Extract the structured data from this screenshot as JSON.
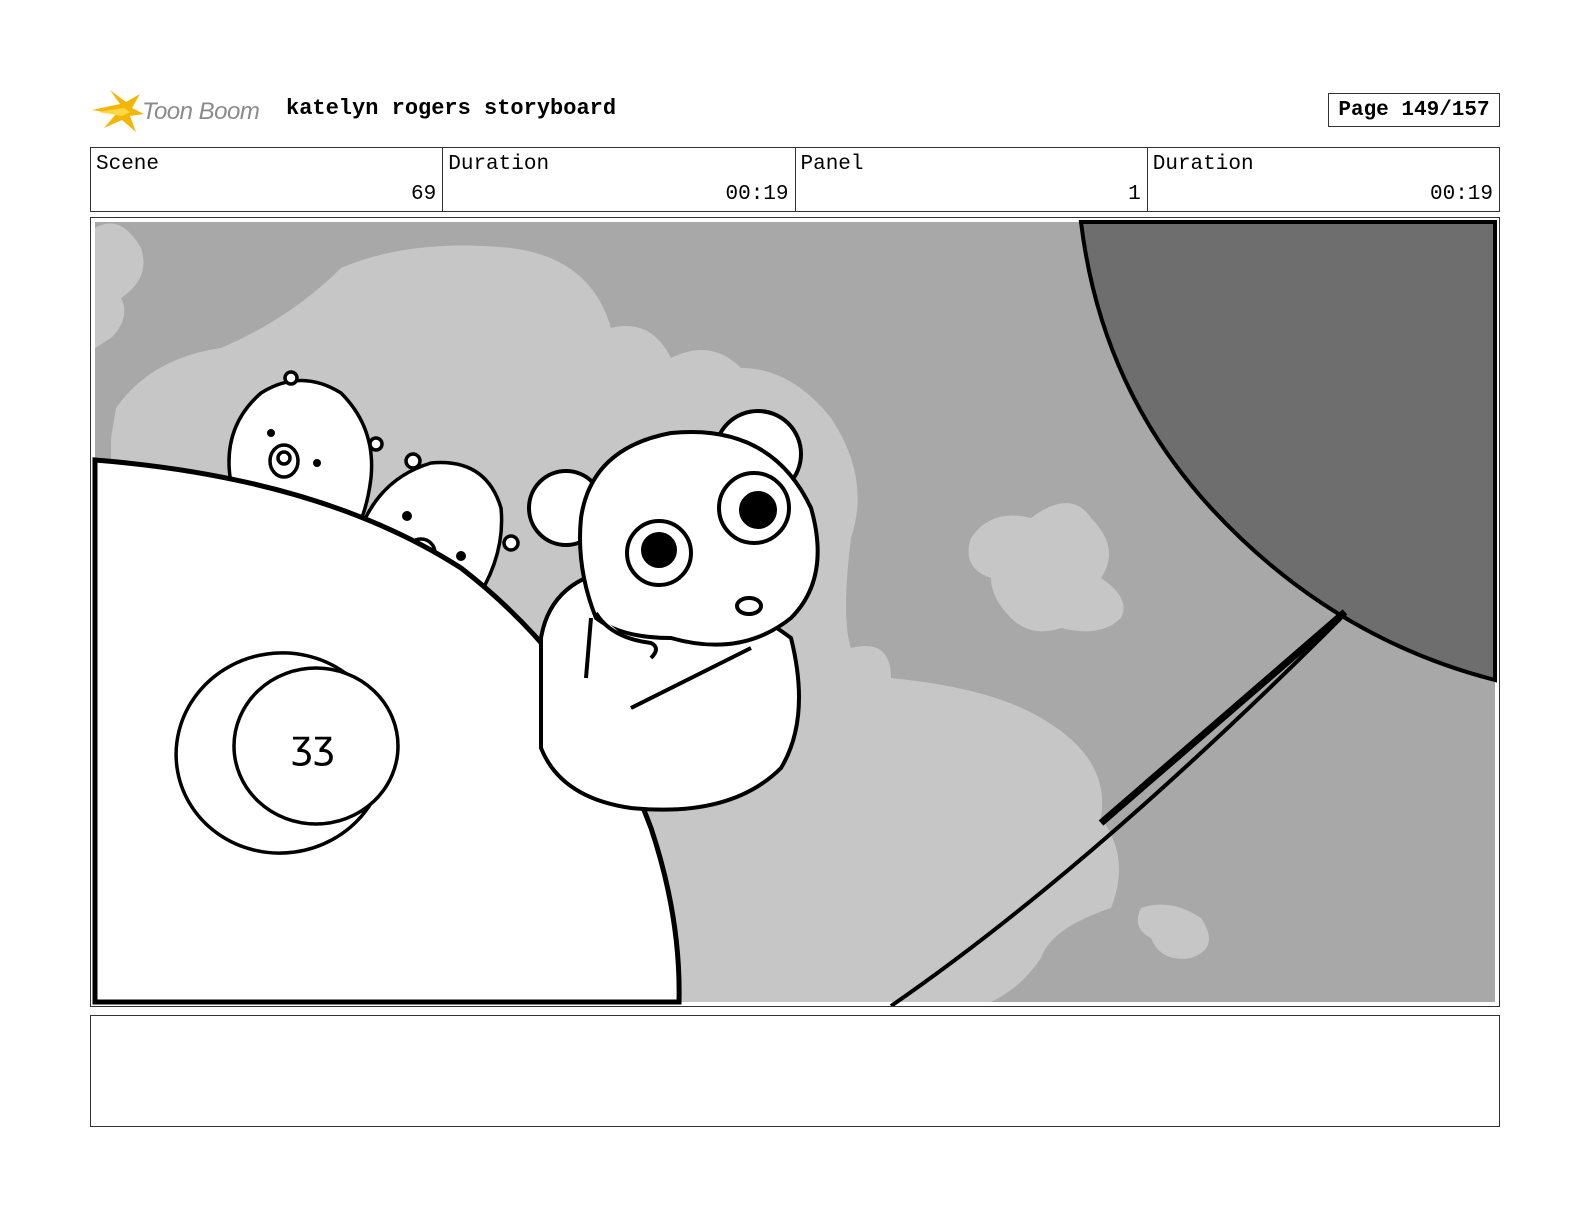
{
  "header": {
    "logo_text": "Toon Boom",
    "title": "katelyn rogers storyboard",
    "page": "Page 149/157"
  },
  "info": {
    "scene_label": "Scene",
    "scene_value": "69",
    "scene_duration_label": "Duration",
    "scene_duration_value": "00:19",
    "panel_label": "Panel",
    "panel_value": "1",
    "panel_duration_label": "Duration",
    "panel_duration_value": "00:19"
  },
  "notes": {
    "text": ""
  },
  "colors": {
    "sky": "#a8a8a8",
    "cloud": "#c6c6c6",
    "dark": "#6e6e6e",
    "ink": "#000000",
    "logo_accent": "#f2b705"
  }
}
